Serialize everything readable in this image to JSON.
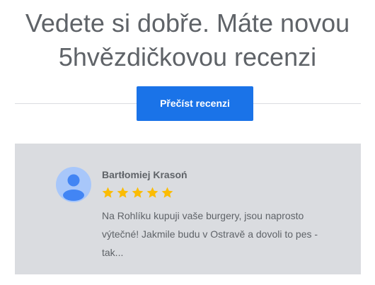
{
  "headline": {
    "line1": "Vedete si dobře. Máte novou",
    "line2": "5hvězdičkovou recenzi"
  },
  "cta": {
    "label": "Přečíst recenzi",
    "color": "#1a73e8"
  },
  "review": {
    "reviewer_name": "Bartłomiej Krasoń",
    "rating": 5,
    "rating_max": 5,
    "star_color": "#fbbc04",
    "text": "Na Rohlíku kupuji vaše burgery, jsou naprosto výtečné! Jakmile budu v Ostravě a dovoli to pes - tak...",
    "avatar_icon": "default-avatar-icon",
    "card_color": "#dadce0"
  }
}
